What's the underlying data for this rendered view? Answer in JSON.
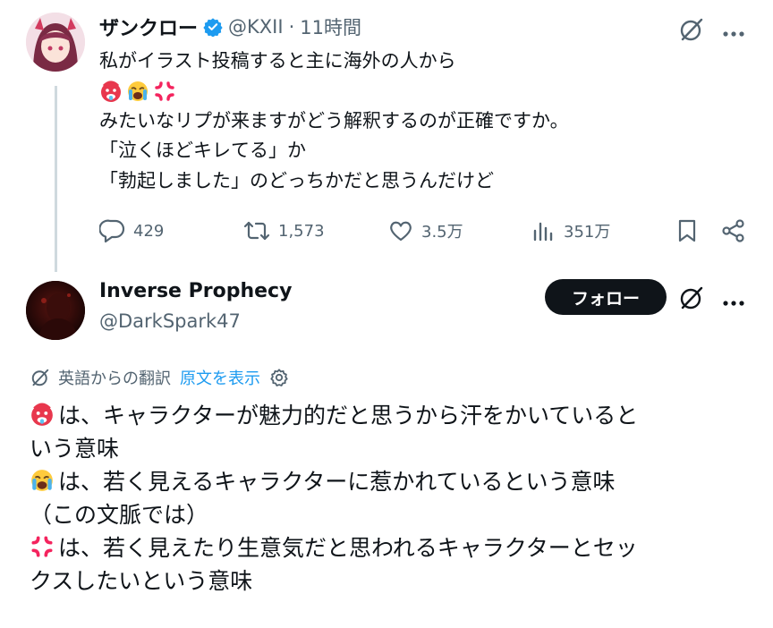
{
  "original_tweet": {
    "display_name": "ザンクロー",
    "handle": "@KXII",
    "separator": "·",
    "time": "11時間",
    "text_line1": "私がイラスト投稿すると主に海外の人から",
    "text_line3": "みたいなリプが来ますがどう解釈するのが正確ですか。",
    "text_line4": "「泣くほどキレてる」か",
    "text_line5": "「勃起しました」のどっちかだと思うんだけど",
    "emoji_row": [
      "hot-face-emoji",
      "crying-face-emoji",
      "anger-symbol-emoji"
    ],
    "stats": {
      "replies": "429",
      "reposts": "1,573",
      "likes": "3.5万",
      "views": "351万"
    }
  },
  "reply": {
    "display_name": "Inverse Prophecy",
    "handle": "@DarkSpark47",
    "follow_label": "フォロー",
    "translation_label": "英語からの翻訳",
    "show_original_label": "原文を表示",
    "line1": "は、キャラクターが魅力的だと思うから汗をかいていると",
    "line2": "いう意味",
    "line3": "は、若く見えるキャラクターに惹かれているという意味",
    "line4": "（この文脈では）",
    "line5": "は、若く見えたり生意気だと思われるキャラクターとセッ",
    "line6": "クスしたいという意味"
  },
  "colors": {
    "text": "#0f1419",
    "secondary": "#536471",
    "link": "#1d9bf0",
    "verified": "#1d9bf0",
    "anger": "#f4245e"
  }
}
